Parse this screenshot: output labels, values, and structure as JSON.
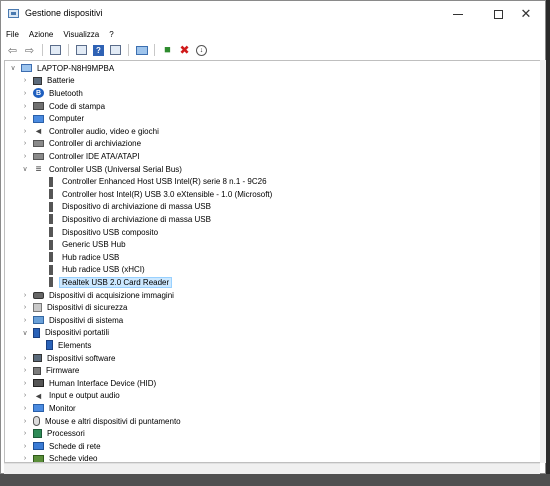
{
  "window": {
    "title": "Gestione dispositivi",
    "controls": {
      "minimize": "—",
      "maximize": "□",
      "close": "✕"
    }
  },
  "menu": [
    "File",
    "Azione",
    "Visualizza",
    "?"
  ],
  "toolbar": {
    "icons": [
      "back-arrow-icon",
      "forward-arrow-icon",
      "show-hide-console-tree-icon",
      "properties-icon",
      "help-icon",
      "action-pane-icon",
      "scan-hardware-icon",
      "update-driver-icon",
      "uninstall-icon",
      "disable-device-icon"
    ]
  },
  "tree": {
    "root": "LAPTOP-N8H9MPBA",
    "items": [
      {
        "label": "Batterie",
        "icon": "battery-icon",
        "expanded": false
      },
      {
        "label": "Bluetooth",
        "icon": "bluetooth-icon",
        "expanded": false
      },
      {
        "label": "Code di stampa",
        "icon": "print-queue-icon",
        "expanded": false
      },
      {
        "label": "Computer",
        "icon": "computer-icon",
        "expanded": false
      },
      {
        "label": "Controller audio, video e giochi",
        "icon": "audio-icon",
        "expanded": false
      },
      {
        "label": "Controller di archiviazione",
        "icon": "storage-controller-icon",
        "expanded": false
      },
      {
        "label": "Controller IDE ATA/ATAPI",
        "icon": "ide-controller-icon",
        "expanded": false
      },
      {
        "label": "Controller USB (Universal Serial Bus)",
        "icon": "usb-controller-icon",
        "expanded": true,
        "children": [
          "Controller Enhanced Host USB Intel(R) serie 8 n.1 - 9C26",
          "Controller host Intel(R) USB 3.0 eXtensible - 1.0 (Microsoft)",
          "Dispositivo di archiviazione di massa USB",
          "Dispositivo di archiviazione di massa USB",
          "Dispositivo USB composito",
          "Generic USB Hub",
          "Hub radice USB",
          "Hub radice USB (xHCI)",
          "Realtek USB 2.0 Card Reader"
        ],
        "selected_child": 8
      },
      {
        "label": "Dispositivi di acquisizione immagini",
        "icon": "camera-icon",
        "expanded": false
      },
      {
        "label": "Dispositivi di sicurezza",
        "icon": "security-device-icon",
        "expanded": false
      },
      {
        "label": "Dispositivi di sistema",
        "icon": "system-device-icon",
        "expanded": false
      },
      {
        "label": "Dispositivi portatili",
        "icon": "portable-device-icon",
        "expanded": true,
        "children": [
          "Elements"
        ]
      },
      {
        "label": "Dispositivi software",
        "icon": "software-device-icon",
        "expanded": false
      },
      {
        "label": "Firmware",
        "icon": "firmware-icon",
        "expanded": false
      },
      {
        "label": "Human Interface Device (HID)",
        "icon": "hid-icon",
        "expanded": false
      },
      {
        "label": "Input e output audio",
        "icon": "audio-io-icon",
        "expanded": false
      },
      {
        "label": "Monitor",
        "icon": "monitor-icon",
        "expanded": false
      },
      {
        "label": "Mouse e altri dispositivi di puntamento",
        "icon": "mouse-icon",
        "expanded": false
      },
      {
        "label": "Processori",
        "icon": "processor-icon",
        "expanded": false
      },
      {
        "label": "Schede di rete",
        "icon": "network-adapter-icon",
        "expanded": false
      },
      {
        "label": "Schede video",
        "icon": "display-adapter-icon",
        "expanded": false
      }
    ]
  }
}
